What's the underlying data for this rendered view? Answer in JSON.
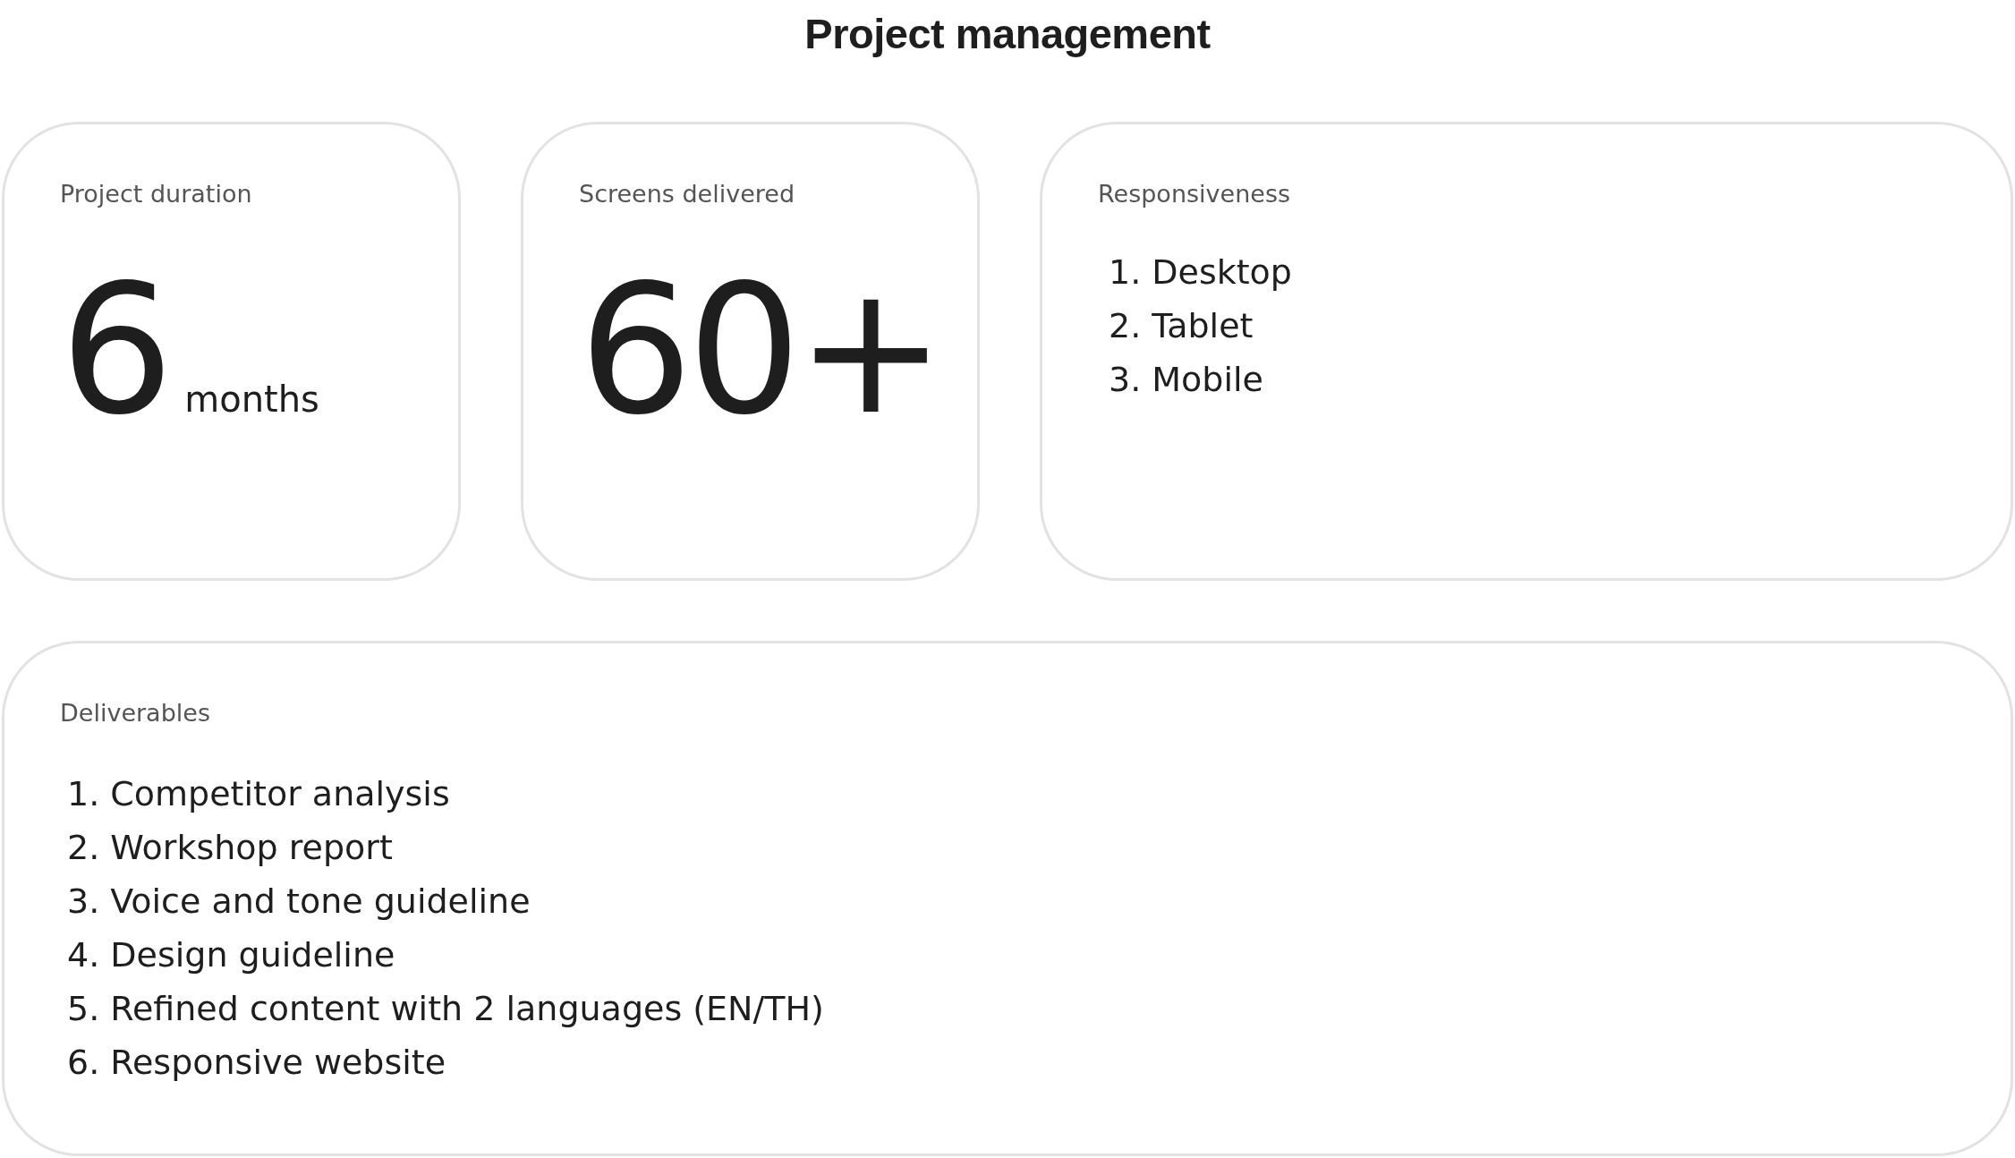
{
  "title": "Project management",
  "stats": [
    {
      "kind": "number",
      "label": "Project duration",
      "value": "6",
      "unit": "months"
    },
    {
      "kind": "number",
      "label": "Screens delivered",
      "value": "60+"
    },
    {
      "kind": "list",
      "label": "Responsiveness",
      "items": [
        {
          "number": "1.",
          "text": "Desktop"
        },
        {
          "number": "2.",
          "text": "Tablet"
        },
        {
          "number": "3.",
          "text": "Mobile"
        }
      ]
    }
  ],
  "deliverables": {
    "label": "Deliverables",
    "items": [
      {
        "number": "1.",
        "text": "Competitor analysis"
      },
      {
        "number": "2.",
        "text": "Workshop report"
      },
      {
        "number": "3.",
        "text": "Voice and tone guideline"
      },
      {
        "number": "4.",
        "text": "Design guideline"
      },
      {
        "number": "5.",
        "text": "Refined content with 2 languages (EN/TH)"
      },
      {
        "number": "6.",
        "text": "Responsive website"
      }
    ]
  }
}
